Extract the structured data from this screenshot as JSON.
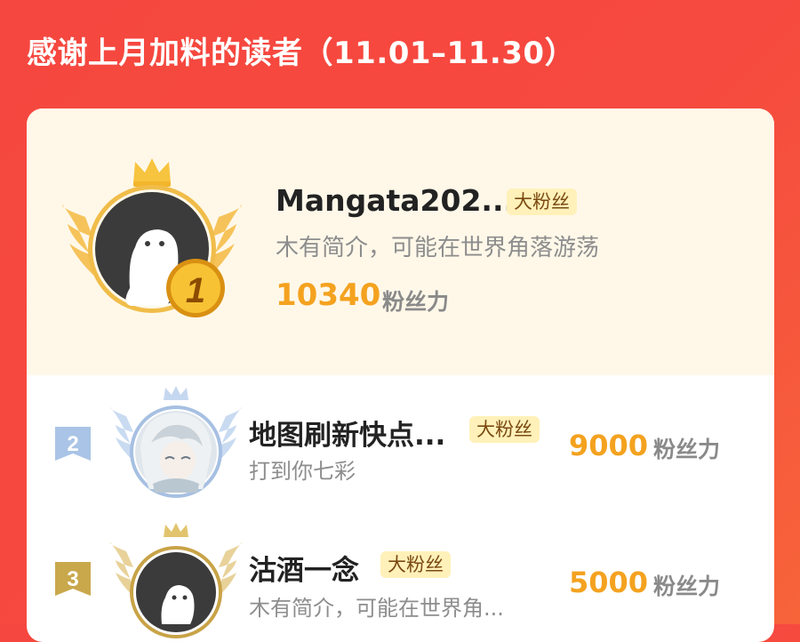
{
  "header": {
    "title": "感谢上月加料的读者（11.01–11.30）"
  },
  "fans": [
    {
      "rank": "1",
      "name": "Mangata202...",
      "badge": "大粉丝",
      "bio": "木有简介，可能在世界角落游荡",
      "score": "10340",
      "score_unit": "粉丝力"
    },
    {
      "rank": "2",
      "name": "地图刷新快点...",
      "badge": "大粉丝",
      "bio": "打到你七彩",
      "score": "9000",
      "score_unit": "粉丝力"
    },
    {
      "rank": "3",
      "name": "沽酒一念",
      "badge": "大粉丝",
      "bio": "木有简介，可能在世界角...",
      "score": "5000",
      "score_unit": "粉丝力"
    }
  ],
  "colors": {
    "background": "#f5473f",
    "gold": "#f4a21f",
    "silver": "#a9c4e6",
    "bronze": "#c9a84c",
    "highlight_row": "#fff8e9"
  },
  "icons": [
    "crown-icon",
    "wings-icon",
    "rank-medal-icon",
    "rank-ribbon-icon",
    "avatar-placeholder-icon"
  ]
}
